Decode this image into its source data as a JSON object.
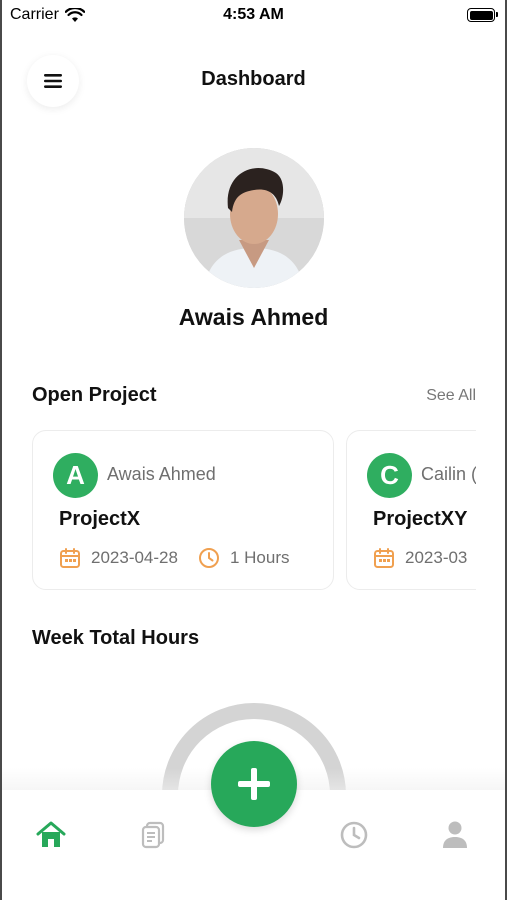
{
  "status_bar": {
    "carrier": "Carrier",
    "time": "4:53 AM",
    "battery_level": 1.0
  },
  "header": {
    "title": "Dashboard",
    "menu_icon": "hamburger-menu-icon"
  },
  "profile": {
    "name": "Awais Ahmed"
  },
  "open_project": {
    "title": "Open Project",
    "see_all_label": "See All",
    "cards": [
      {
        "initial": "A",
        "owner": "Awais Ahmed",
        "project": "ProjectX",
        "date": "2023-04-28",
        "hours": "1 Hours"
      },
      {
        "initial": "C",
        "owner": "Cailin (",
        "project": "ProjectXY",
        "date": "2023-03",
        "hours": ""
      }
    ]
  },
  "week_total": {
    "title": "Week Total Hours"
  },
  "tabs": [
    {
      "icon": "home-icon",
      "active": true
    },
    {
      "icon": "documents-icon",
      "active": false
    },
    {
      "icon": "clock-icon",
      "active": false
    },
    {
      "icon": "profile-icon",
      "active": false
    }
  ],
  "colors": {
    "accent_green": "#27a85a",
    "orange_icon": "#f0a050",
    "muted_gray": "#bdbdbd"
  }
}
